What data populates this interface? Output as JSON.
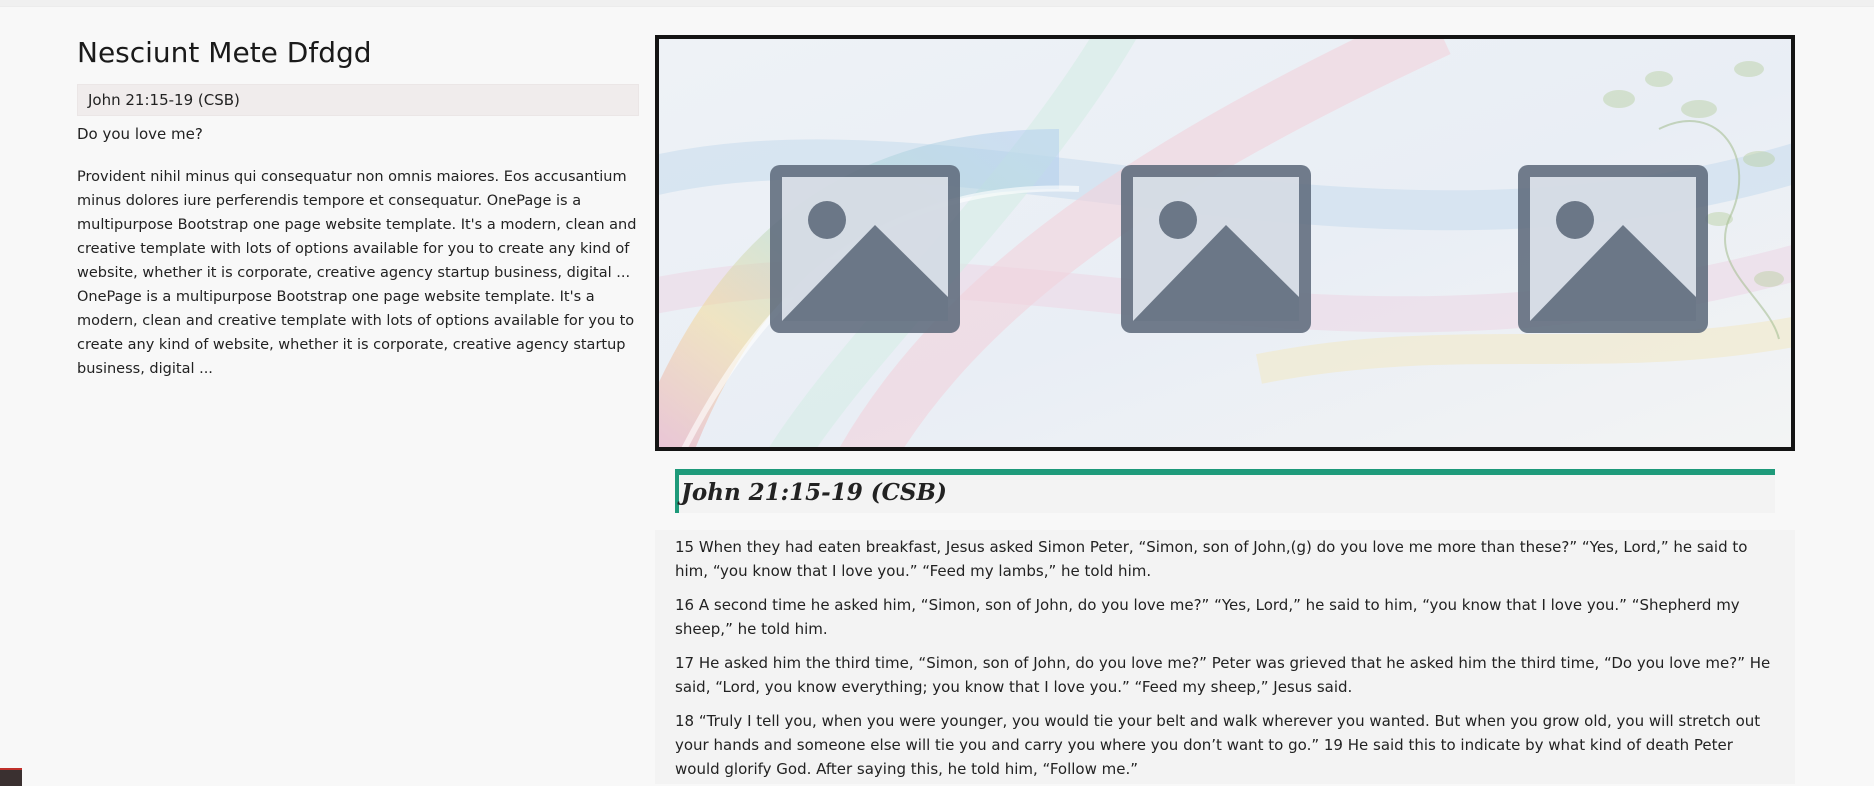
{
  "page": {
    "title": "Nesciunt Mete Dfdgd",
    "reference_label": "John 21:15-19 (CSB)",
    "question": "Do you love me?",
    "description": "Provident nihil minus qui consequatur non omnis maiores. Eos accusantium minus dolores iure perferendis tempore et consequatur. OnePage is a multipurpose Bootstrap one page website template. It's a modern, clean and creative template with lots of options available for you to create any kind of website, whether it is corporate, creative agency startup business, digital ... OnePage is a multipurpose Bootstrap one page website template. It's a modern, clean and creative template with lots of options available for you to create any kind of website, whether it is corporate, creative agency startup business, digital ..."
  },
  "banner": {
    "placeholders": [
      "image-placeholder-icon",
      "image-placeholder-icon",
      "image-placeholder-icon"
    ]
  },
  "scripture": {
    "heading": "John 21:15-19 (CSB)",
    "verses": [
      "15 When they had eaten breakfast, Jesus asked Simon Peter, “Simon, son of John,(g) do you love me more than these?” “Yes, Lord,” he said to him, “you know that I love you.” “Feed my lambs,” he told him.",
      "16 A second time he asked him, “Simon, son of John, do you love me?” “Yes, Lord,” he said to him, “you know that I love you.” “Shepherd my sheep,” he told him.",
      "17 He asked him the third time, “Simon, son of John, do you love me?” Peter was grieved that he asked him the third time, “Do you love me?” He said, “Lord, you know everything; you know that I love you.” “Feed my sheep,” Jesus said.",
      "18 “Truly I tell you, when you were younger, you would tie your belt and walk wherever you wanted. But when you grow old, you will stretch out your hands and someone else will tie you and carry you where you don’t want to go.” 19 He said this to indicate by what kind of death Peter would glorify God. After saying this, he told him, “Follow me.”"
    ]
  },
  "colors": {
    "accent": "#1e9a7a",
    "banner_border": "#141414",
    "placeholder": "#5f6b7c"
  }
}
